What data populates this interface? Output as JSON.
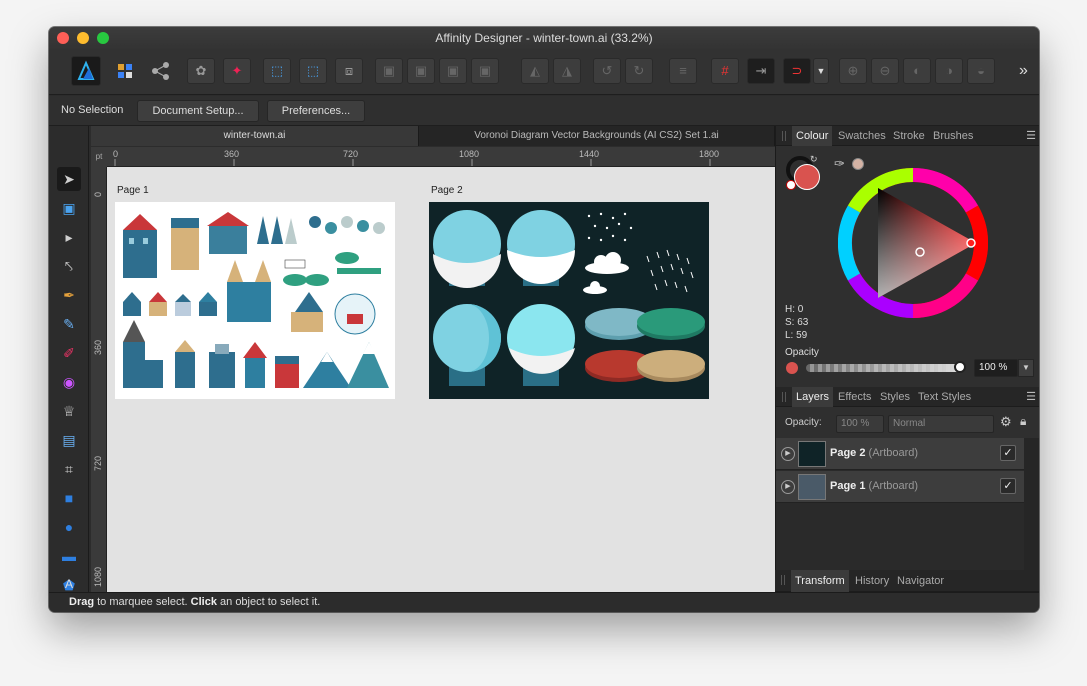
{
  "window": {
    "title": "Affinity Designer - winter-town.ai (33.2%)"
  },
  "toolbar": {
    "overflow": "»"
  },
  "context_bar": {
    "selection_label": "No Selection",
    "document_setup_label": "Document Setup...",
    "preferences_label": "Preferences..."
  },
  "document_tabs": [
    {
      "label": "winter-town.ai",
      "active": true
    },
    {
      "label": "Voronoi Diagram Vector Backgrounds (AI CS2) Set 1.ai",
      "active": false
    }
  ],
  "ruler": {
    "unit": "pt",
    "h_ticks": [
      "0",
      "360",
      "720",
      "1080",
      "1440",
      "1800"
    ],
    "v_ticks": [
      "0",
      "360",
      "720",
      "1080"
    ]
  },
  "canvas": {
    "pages": [
      {
        "label": "Page 1"
      },
      {
        "label": "Page 2"
      }
    ]
  },
  "status": {
    "drag": "Drag",
    "mid": " to marquee select. ",
    "click": "Click",
    "end": " an object to select it."
  },
  "colour_panel": {
    "tabs": [
      "Colour",
      "Swatches",
      "Stroke",
      "Brushes"
    ],
    "h": "H: 0",
    "s": "S: 63",
    "l": "L: 59",
    "opacity_label": "Opacity",
    "opacity_value": "100 %",
    "fill_color": "#d9534f"
  },
  "layers_panel": {
    "tabs": [
      "Layers",
      "Effects",
      "Styles",
      "Text Styles"
    ],
    "opacity_label": "Opacity:",
    "opacity_value": "100 %",
    "blend_mode": "Normal",
    "layers": [
      {
        "name": "Page 2",
        "type": "(Artboard)",
        "checked": "✓"
      },
      {
        "name": "Page 1",
        "type": "(Artboard)",
        "checked": "✓"
      }
    ]
  },
  "bottom_tabs": [
    "Transform",
    "History",
    "Navigator"
  ]
}
